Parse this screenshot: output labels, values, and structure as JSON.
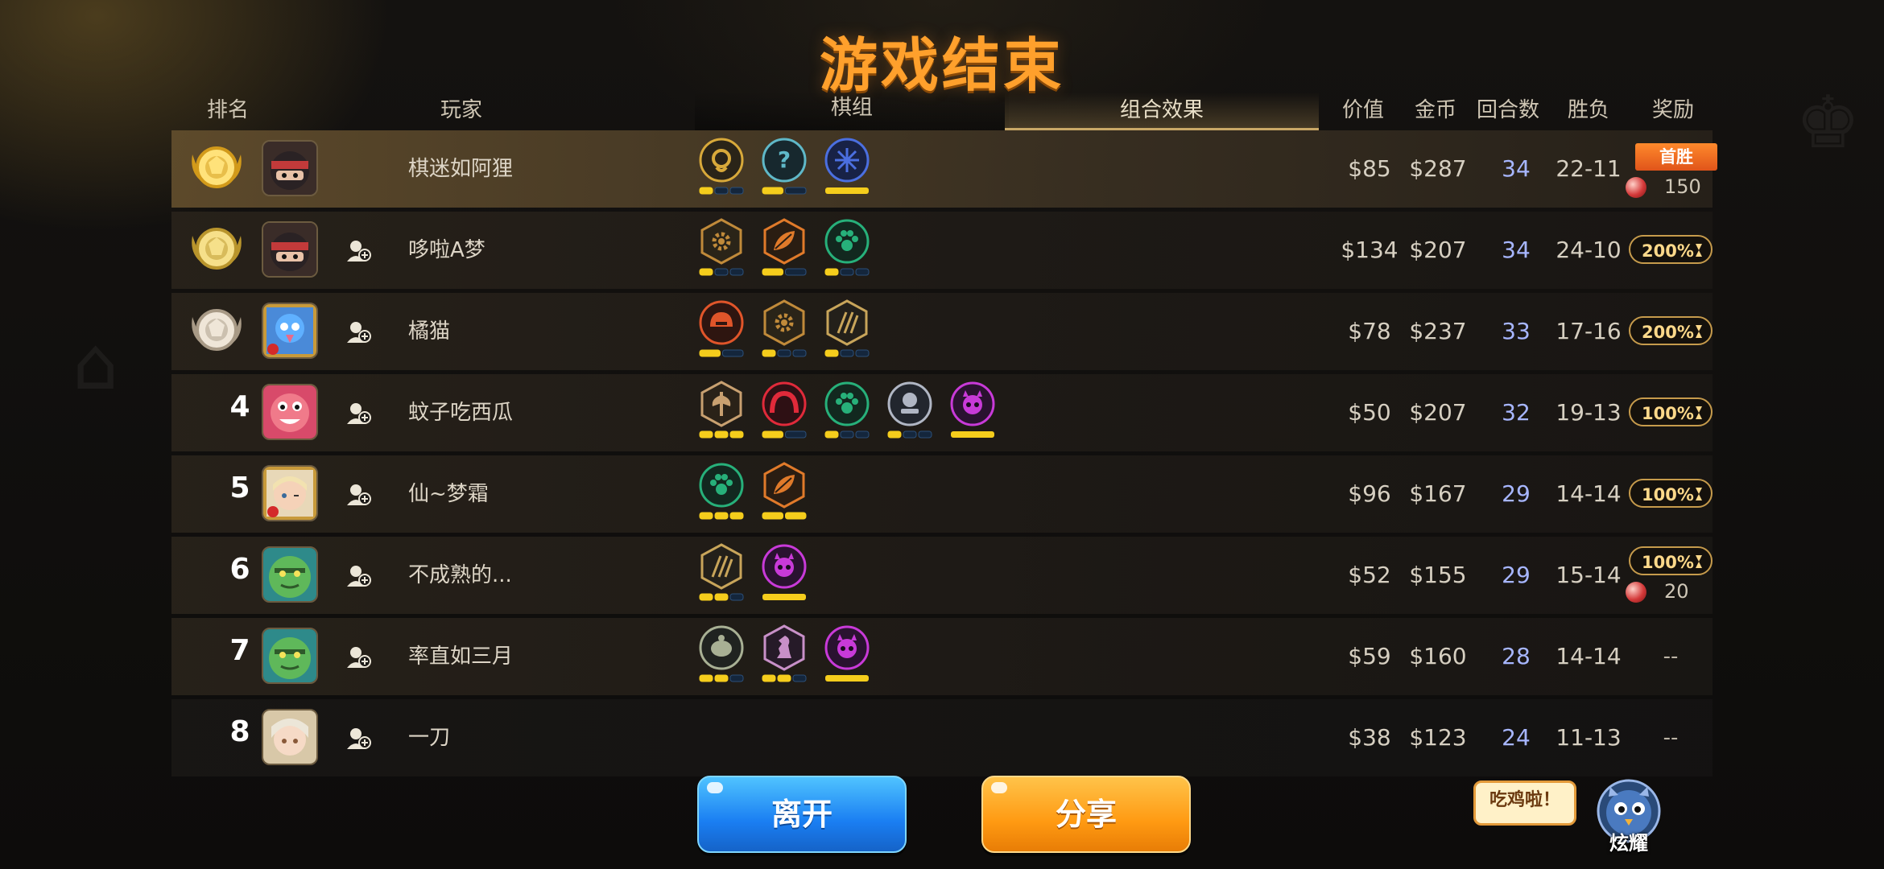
{
  "title": "游戏结束",
  "headers": {
    "rank": "排名",
    "player": "玩家",
    "pieces": "棋组",
    "combo": "组合效果",
    "value": "价值",
    "gold": "金币",
    "rounds": "回合数",
    "winloss": "胜负",
    "reward": "奖励"
  },
  "rows": [
    {
      "rank": "",
      "badge": "gold",
      "avatar": "ninja",
      "name": "棋迷如阿狸",
      "traits": [
        {
          "icon": "ring",
          "color": "#d8a93a",
          "fill": "#2a2418",
          "pips": [
            1,
            0,
            0
          ]
        },
        {
          "icon": "question",
          "color": "#5fb8c8",
          "fill": "#17282e",
          "pips": [
            1,
            0
          ]
        },
        {
          "icon": "shatter",
          "color": "#4b6fe0",
          "fill": "#182246",
          "pips": [
            1
          ]
        }
      ],
      "value": "$85",
      "gold": "$287",
      "rounds": "34",
      "wl": "22-11",
      "reward": {
        "type": "firstwin",
        "label": "首胜",
        "coins": "150"
      }
    },
    {
      "rank": "",
      "badge": "silver-gold",
      "avatar": "ninja",
      "name": "哆啦A梦",
      "traits": [
        {
          "icon": "gear",
          "color": "#c08a3a",
          "fill": "#2a2418",
          "pips": [
            1,
            0,
            0
          ]
        },
        {
          "icon": "leaf",
          "color": "#e07a2a",
          "fill": "#2a1d12",
          "pips": [
            1,
            0
          ]
        },
        {
          "icon": "paw",
          "color": "#27b07a",
          "fill": "#12281f",
          "pips": [
            1,
            0,
            0
          ]
        }
      ],
      "value": "$134",
      "gold": "$207",
      "rounds": "34",
      "wl": "24-10",
      "reward": {
        "type": "pill",
        "label": "200%"
      }
    },
    {
      "rank": "",
      "badge": "bronze",
      "avatar": "bird",
      "name": "橘猫",
      "traits": [
        {
          "icon": "helmet",
          "color": "#e0552a",
          "fill": "#2e1510",
          "pips": [
            1,
            0
          ]
        },
        {
          "icon": "gear",
          "color": "#c08a3a",
          "fill": "#2a2418",
          "pips": [
            1,
            0,
            0
          ]
        },
        {
          "icon": "claw",
          "color": "#c8a55a",
          "fill": "#23201a",
          "pips": [
            1,
            0,
            0
          ]
        }
      ],
      "value": "$78",
      "gold": "$237",
      "rounds": "33",
      "wl": "17-16",
      "reward": {
        "type": "pill",
        "label": "200%"
      }
    },
    {
      "rank": "4",
      "badge": "none",
      "avatar": "pinkmonster",
      "name": "蚊子吃西瓜",
      "traits": [
        {
          "icon": "axe",
          "color": "#c8a070",
          "fill": "#2a2218",
          "pips": [
            1,
            1,
            1
          ]
        },
        {
          "icon": "arch",
          "color": "#e02a3a",
          "fill": "#2e1014",
          "pips": [
            1,
            0
          ]
        },
        {
          "icon": "paw",
          "color": "#27b07a",
          "fill": "#12281f",
          "pips": [
            1,
            0,
            0
          ]
        },
        {
          "icon": "knight",
          "color": "#b0b6c4",
          "fill": "#22262e",
          "pips": [
            1,
            0,
            0
          ]
        },
        {
          "icon": "demon",
          "color": "#c83ad8",
          "fill": "#2a1230",
          "pips": [
            1
          ]
        }
      ],
      "value": "$50",
      "gold": "$207",
      "rounds": "32",
      "wl": "19-13",
      "reward": {
        "type": "pill",
        "label": "100%"
      }
    },
    {
      "rank": "5",
      "badge": "none",
      "avatar": "girl",
      "name": "仙~梦霜",
      "traits": [
        {
          "icon": "paw",
          "color": "#27b07a",
          "fill": "#12281f",
          "pips": [
            1,
            1,
            1
          ]
        },
        {
          "icon": "leaf",
          "color": "#e07a2a",
          "fill": "#2a1d12",
          "pips": [
            1,
            1
          ]
        }
      ],
      "value": "$96",
      "gold": "$167",
      "rounds": "29",
      "wl": "14-14",
      "reward": {
        "type": "pill",
        "label": "100%"
      }
    },
    {
      "rank": "6",
      "badge": "none",
      "avatar": "greenorc",
      "name": "不成熟的...",
      "traits": [
        {
          "icon": "claw",
          "color": "#c8a55a",
          "fill": "#23201a",
          "pips": [
            1,
            1,
            0
          ]
        },
        {
          "icon": "demon",
          "color": "#c83ad8",
          "fill": "#2a1230",
          "pips": [
            1
          ]
        }
      ],
      "value": "$52",
      "gold": "$155",
      "rounds": "29",
      "wl": "15-14",
      "reward": {
        "type": "pill-coins",
        "label": "100%",
        "coins": "20"
      }
    },
    {
      "rank": "7",
      "badge": "none",
      "avatar": "greenorc",
      "name": "率直如三月",
      "traits": [
        {
          "icon": "turtle",
          "color": "#a8b094",
          "fill": "#202320",
          "pips": [
            1,
            1,
            0
          ]
        },
        {
          "icon": "chess",
          "color": "#c890c8",
          "fill": "#261a28",
          "pips": [
            1,
            1,
            0
          ]
        },
        {
          "icon": "demon",
          "color": "#c83ad8",
          "fill": "#2a1230",
          "pips": [
            1
          ]
        }
      ],
      "value": "$59",
      "gold": "$160",
      "rounds": "28",
      "wl": "14-14",
      "reward": {
        "type": "dash",
        "label": "--"
      }
    },
    {
      "rank": "8",
      "badge": "none",
      "avatar": "girl2",
      "name": "一刀",
      "traits": [],
      "value": "$38",
      "gold": "$123",
      "rounds": "24",
      "wl": "11-13",
      "reward": {
        "type": "dash",
        "label": "--"
      }
    }
  ],
  "buttons": {
    "leave": "离开",
    "share": "分享"
  },
  "bubble": "吃鸡啦！",
  "flaunt": "炫耀"
}
